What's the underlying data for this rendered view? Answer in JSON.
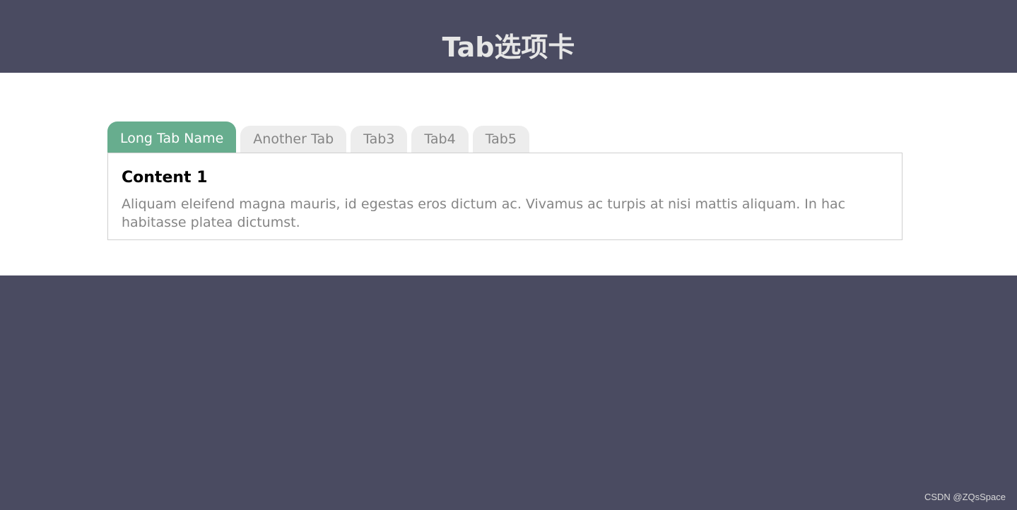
{
  "header": {
    "title": "Tab选项卡"
  },
  "tabs": [
    {
      "label": "Long Tab Name",
      "active": true
    },
    {
      "label": "Another Tab",
      "active": false
    },
    {
      "label": "Tab3",
      "active": false
    },
    {
      "label": "Tab4",
      "active": false
    },
    {
      "label": "Tab5",
      "active": false
    }
  ],
  "content": {
    "title": "Content 1",
    "text": "Aliquam eleifend magna mauris, id egestas eros dictum ac. Vivamus ac turpis at nisi mattis aliquam. In hac habitasse platea dictumst."
  },
  "watermark": "CSDN @ZQsSpace",
  "colors": {
    "background": "#4a4b61",
    "active_tab": "#67ad8e",
    "inactive_tab": "#ededed",
    "inactive_tab_text": "#858585",
    "panel_border": "#cfcfcf"
  }
}
